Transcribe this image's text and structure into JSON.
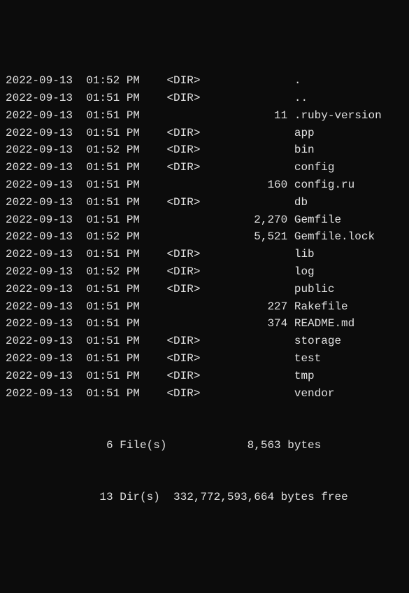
{
  "listing": {
    "entries": [
      {
        "date": "2022-09-13",
        "time": "01:52 PM",
        "type": "<DIR>",
        "size": "",
        "name": "."
      },
      {
        "date": "2022-09-13",
        "time": "01:51 PM",
        "type": "<DIR>",
        "size": "",
        "name": ".."
      },
      {
        "date": "2022-09-13",
        "time": "01:51 PM",
        "type": "",
        "size": "11",
        "name": ".ruby-version"
      },
      {
        "date": "2022-09-13",
        "time": "01:51 PM",
        "type": "<DIR>",
        "size": "",
        "name": "app"
      },
      {
        "date": "2022-09-13",
        "time": "01:52 PM",
        "type": "<DIR>",
        "size": "",
        "name": "bin"
      },
      {
        "date": "2022-09-13",
        "time": "01:51 PM",
        "type": "<DIR>",
        "size": "",
        "name": "config"
      },
      {
        "date": "2022-09-13",
        "time": "01:51 PM",
        "type": "",
        "size": "160",
        "name": "config.ru"
      },
      {
        "date": "2022-09-13",
        "time": "01:51 PM",
        "type": "<DIR>",
        "size": "",
        "name": "db"
      },
      {
        "date": "2022-09-13",
        "time": "01:51 PM",
        "type": "",
        "size": "2,270",
        "name": "Gemfile"
      },
      {
        "date": "2022-09-13",
        "time": "01:52 PM",
        "type": "",
        "size": "5,521",
        "name": "Gemfile.lock"
      },
      {
        "date": "2022-09-13",
        "time": "01:51 PM",
        "type": "<DIR>",
        "size": "",
        "name": "lib"
      },
      {
        "date": "2022-09-13",
        "time": "01:52 PM",
        "type": "<DIR>",
        "size": "",
        "name": "log"
      },
      {
        "date": "2022-09-13",
        "time": "01:51 PM",
        "type": "<DIR>",
        "size": "",
        "name": "public"
      },
      {
        "date": "2022-09-13",
        "time": "01:51 PM",
        "type": "",
        "size": "227",
        "name": "Rakefile"
      },
      {
        "date": "2022-09-13",
        "time": "01:51 PM",
        "type": "",
        "size": "374",
        "name": "README.md"
      },
      {
        "date": "2022-09-13",
        "time": "01:51 PM",
        "type": "<DIR>",
        "size": "",
        "name": "storage"
      },
      {
        "date": "2022-09-13",
        "time": "01:51 PM",
        "type": "<DIR>",
        "size": "",
        "name": "test"
      },
      {
        "date": "2022-09-13",
        "time": "01:51 PM",
        "type": "<DIR>",
        "size": "",
        "name": "tmp"
      },
      {
        "date": "2022-09-13",
        "time": "01:51 PM",
        "type": "<DIR>",
        "size": "",
        "name": "vendor"
      }
    ],
    "summary": {
      "file_count": "6 File(s)",
      "total_bytes": "8,563 bytes",
      "dir_count": "13 Dir(s)",
      "free_bytes": "332,772,593,664 bytes free"
    }
  }
}
